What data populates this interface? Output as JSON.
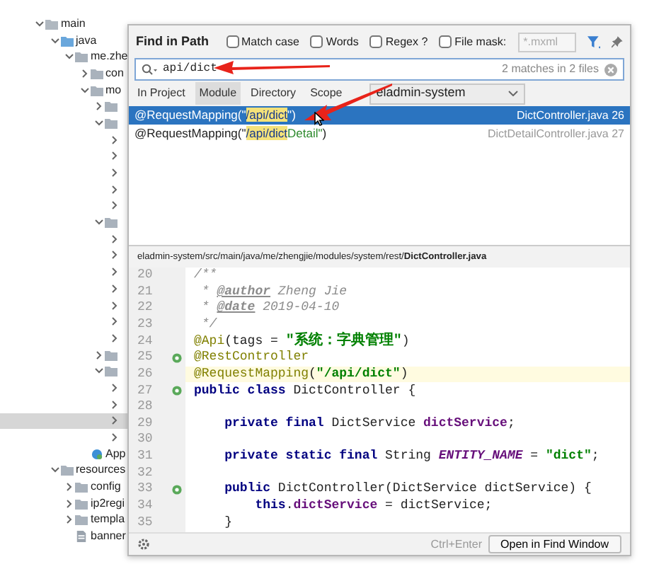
{
  "project_tree": [
    {
      "label": "main",
      "kind": "folder",
      "expanded": true,
      "selected": false,
      "children": [
        {
          "label": "java",
          "kind": "source",
          "expanded": true,
          "selected": false,
          "children": [
            {
              "label": "me.zhe",
              "kind": "package",
              "expanded": true,
              "selected": false,
              "children": [
                {
                  "label": "con",
                  "kind": "package",
                  "expanded": false,
                  "selected": false
                },
                {
                  "label": "mo",
                  "kind": "package",
                  "expanded": true,
                  "selected": false,
                  "children": [
                    {
                      "kind": "package",
                      "expanded": false,
                      "selected": false
                    },
                    {
                      "kind": "package",
                      "expanded": true,
                      "selected": false,
                      "children": [
                        {
                          "expanded": false,
                          "selected": false
                        },
                        {
                          "expanded": false,
                          "selected": false
                        },
                        {
                          "expanded": false,
                          "selected": false
                        },
                        {
                          "expanded": false,
                          "selected": false
                        },
                        {
                          "expanded": false,
                          "selected": false
                        }
                      ]
                    },
                    {
                      "kind": "package",
                      "expanded": true,
                      "selected": false,
                      "children": [
                        {
                          "expanded": false,
                          "selected": false
                        },
                        {
                          "expanded": false,
                          "selected": false
                        },
                        {
                          "expanded": false,
                          "selected": false
                        },
                        {
                          "expanded": false,
                          "selected": false
                        },
                        {
                          "expanded": false,
                          "selected": false
                        },
                        {
                          "expanded": false,
                          "selected": false
                        },
                        {
                          "expanded": false,
                          "selected": false
                        }
                      ]
                    },
                    {
                      "kind": "package",
                      "expanded": false,
                      "selected": false
                    },
                    {
                      "kind": "package",
                      "expanded": true,
                      "selected": false,
                      "children": [
                        {
                          "expanded": false,
                          "selected": false
                        },
                        {
                          "expanded": false,
                          "selected": false
                        },
                        {
                          "expanded": false,
                          "selected": true
                        },
                        {
                          "expanded": false,
                          "selected": false
                        }
                      ]
                    }
                  ]
                },
                {
                  "label": "App",
                  "kind": "class",
                  "selected": false
                }
              ]
            }
          ]
        },
        {
          "label": "resources",
          "kind": "resources",
          "expanded": true,
          "selected": false,
          "children": [
            {
              "label": "config",
              "kind": "package",
              "expanded": false,
              "selected": false
            },
            {
              "label": "ip2regi",
              "kind": "package",
              "expanded": false,
              "selected": false
            },
            {
              "label": "templa",
              "kind": "package",
              "expanded": false,
              "selected": false
            },
            {
              "label": "banner",
              "kind": "file",
              "selected": false
            }
          ]
        }
      ]
    }
  ],
  "find_dialog": {
    "title": "Find in Path",
    "options": [
      {
        "label": "Match case",
        "checked": false
      },
      {
        "label": "Words",
        "checked": false
      },
      {
        "label": "Regex ?",
        "checked": false
      },
      {
        "label": "File mask:",
        "checked": false
      }
    ],
    "file_mask": {
      "value": "*.mxml",
      "disabled": true
    },
    "search": {
      "value": "api/dict",
      "summary": "2 matches in 2 files"
    },
    "scope_tabs": [
      {
        "label": "In Project",
        "selected": false
      },
      {
        "label": "Module",
        "selected": true
      },
      {
        "label": "Directory",
        "selected": false
      },
      {
        "label": "Scope",
        "selected": false
      }
    ],
    "scope_value": "eladmin-system",
    "results": [
      {
        "selected": true,
        "segments": [
          {
            "kind": "plain",
            "text": "@RequestMapping(\""
          },
          {
            "kind": "match",
            "text": "/api/dict"
          },
          {
            "kind": "plain",
            "text": "\")"
          }
        ],
        "file": "DictController.java 26"
      },
      {
        "selected": false,
        "segments": [
          {
            "kind": "plain",
            "text": "@RequestMapping(\""
          },
          {
            "kind": "match",
            "text": "/api/dict"
          },
          {
            "kind": "str",
            "text": "Detail\""
          },
          {
            "kind": "plain",
            "text": ")"
          }
        ],
        "file": "DictDetailController.java 27"
      }
    ],
    "preview": {
      "path": "eladmin-system/src/main/java/me/zhengjie/modules/system/rest/**DictController.java**",
      "lines": [
        {
          "number": "20",
          "current": false,
          "marker": false,
          "tokens": [
            {
              "kind": "com",
              "text": "/**"
            }
          ]
        },
        {
          "number": "21",
          "current": false,
          "marker": false,
          "tokens": [
            {
              "kind": "com",
              "text": " * "
            },
            {
              "kind": "tag",
              "text": "@author"
            },
            {
              "kind": "com",
              "text": " Zheng Jie"
            }
          ]
        },
        {
          "number": "22",
          "current": false,
          "marker": false,
          "tokens": [
            {
              "kind": "com",
              "text": " * "
            },
            {
              "kind": "tag",
              "text": "@date"
            },
            {
              "kind": "com",
              "text": " 2019-04-10"
            }
          ]
        },
        {
          "number": "23",
          "current": false,
          "marker": false,
          "tokens": [
            {
              "kind": "com",
              "text": " */"
            }
          ]
        },
        {
          "number": "24",
          "current": false,
          "marker": false,
          "tokens": [
            {
              "kind": "ann",
              "text": "@Api"
            },
            {
              "kind": "plain",
              "text": "(tags = "
            },
            {
              "kind": "cjk",
              "text": "\"系统：字典管理\""
            },
            {
              "kind": "plain",
              "text": ")"
            }
          ]
        },
        {
          "number": "25",
          "current": false,
          "marker": true,
          "tokens": [
            {
              "kind": "ann",
              "text": "@RestController"
            }
          ]
        },
        {
          "number": "26",
          "current": true,
          "marker": false,
          "tokens": [
            {
              "kind": "ann",
              "text": "@RequestMapping"
            },
            {
              "kind": "plain",
              "text": "("
            },
            {
              "kind": "str",
              "text": "\"/api/dict\""
            },
            {
              "kind": "plain",
              "text": ")"
            }
          ]
        },
        {
          "number": "27",
          "current": false,
          "marker": true,
          "tokens": [
            {
              "kind": "kw",
              "text": "public class "
            },
            {
              "kind": "plain",
              "text": "DictController {"
            }
          ]
        },
        {
          "number": "28",
          "current": false,
          "marker": false
        },
        {
          "number": "29",
          "current": false,
          "marker": false,
          "tokens": [
            {
              "kind": "kw",
              "text": "    private final "
            },
            {
              "kind": "plain",
              "text": "DictService "
            },
            {
              "kind": "field",
              "text": "dictService"
            },
            {
              "kind": "plain",
              "text": ";"
            }
          ]
        },
        {
          "number": "30",
          "current": false,
          "marker": false
        },
        {
          "number": "31",
          "current": false,
          "marker": false,
          "tokens": [
            {
              "kind": "kw",
              "text": "    private static final "
            },
            {
              "kind": "plain",
              "text": "String "
            },
            {
              "kind": "const",
              "text": "ENTITY_NAME"
            },
            {
              "kind": "plain",
              "text": " = "
            },
            {
              "kind": "str",
              "text": "\"dict\""
            },
            {
              "kind": "plain",
              "text": ";"
            }
          ]
        },
        {
          "number": "32",
          "current": false,
          "marker": false
        },
        {
          "number": "33",
          "current": false,
          "marker": true,
          "tokens": [
            {
              "kind": "kw",
              "text": "    public "
            },
            {
              "kind": "plain",
              "text": "DictController(DictService dictService) {"
            }
          ]
        },
        {
          "number": "34",
          "current": false,
          "marker": false,
          "tokens": [
            {
              "kind": "kw",
              "text": "        this"
            },
            {
              "kind": "plain",
              "text": "."
            },
            {
              "kind": "field",
              "text": "dictService"
            },
            {
              "kind": "plain",
              "text": " = dictService;"
            }
          ]
        },
        {
          "number": "35",
          "current": false,
          "marker": false,
          "tokens": [
            {
              "kind": "plain",
              "text": "    }"
            }
          ]
        }
      ]
    },
    "shortcut": "Ctrl+Enter",
    "open_button": "Open in Find Window"
  }
}
